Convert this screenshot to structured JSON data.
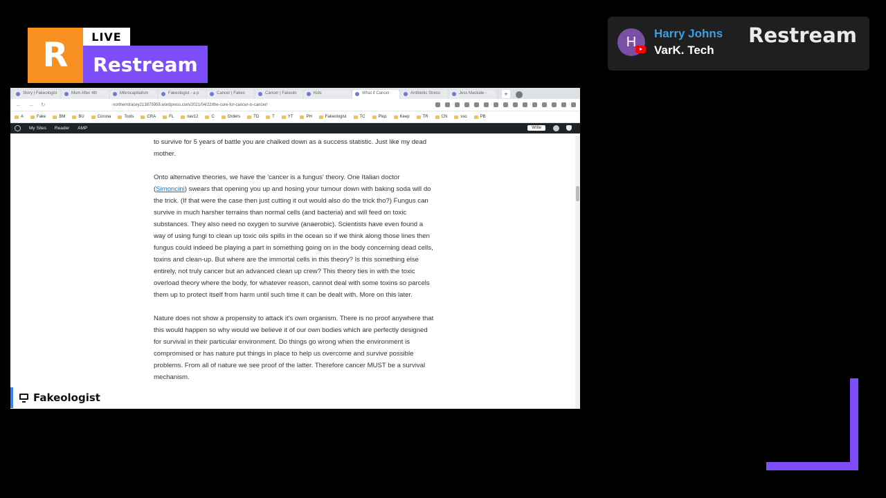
{
  "overlay": {
    "logo": {
      "letter": "R",
      "live": "LIVE",
      "brand": "Restream"
    },
    "chat": {
      "avatar_initial": "H",
      "author": "Harry Johns",
      "message": "VarK. Tech",
      "brand": "Restream"
    },
    "screen_label": "Fakeologist",
    "accent_color": "#7d4dfa",
    "orange_color": "#f7901e"
  },
  "browser": {
    "tabs": [
      {
        "label": "Story | Fakeologist"
      },
      {
        "label": "Mum After 4th"
      },
      {
        "label": "Mikrocapitalism"
      },
      {
        "label": "Fakeologist - a p"
      },
      {
        "label": "Cancer | Fakeo"
      },
      {
        "label": "Cancer | Fakeolo"
      },
      {
        "label": "Kids"
      },
      {
        "label": "What if Cancer"
      },
      {
        "label": "Antibiotic Stress"
      },
      {
        "label": "Jess Mackale -"
      }
    ],
    "new_tab": "+",
    "url": "northerntracey213875959.wordpress.com/2021/04/22/the-cure-for-cancer-is-cancer/",
    "bookmarks": [
      "A",
      "Fake",
      "BM",
      "BU",
      "Corona",
      "Tools",
      "CRA",
      "FL",
      "nav12",
      "C",
      "Orders",
      "TD",
      "T",
      "YT",
      "PH",
      "Fakeologist",
      "TC",
      "Plup",
      "Keep",
      "TR",
      "CN",
      "sso",
      "PB"
    ],
    "wp_toolbar": {
      "my_sites": "My Sites",
      "reader": "Reader",
      "amp": "AMP",
      "write": "Write"
    }
  },
  "article": {
    "p1": "to survive for 5 years of battle you are chalked down as a success statistic. Just like my dead mother.",
    "p2_a": "Onto alternative theories, we have the 'cancer is a fungus' theory. One Italian doctor (",
    "p2_link": "Simoncini",
    "p2_b": ") swears that opening you up and hosing your tumour down with baking soda will do the trick. (If that were the case then just cutting it out would also do the trick tho?) Fungus can survive in much harsher terrains than normal cells (and bacteria) and will feed on toxic substances. They also need no oxygen to survive (anaerobic). Scientists have even found a way of using fungi to clean up toxic oils spills in the ocean so if we think along those lines then fungus could indeed be playing a part in something going on in the body concerning dead cells, toxins and clean-up. But where are the immortal cells in this theory? Is this something else entirely, not truly cancer but an advanced clean up crew? This theory ties in with the toxic overload theory where the body, for whatever reason, cannot deal with some toxins so parcels them up to protect itself from harm until such time it can be dealt with. More on this later.",
    "p3": "Nature does not show a propensity to attack it's own organism. There is no proof anywhere that this would happen so why would we believe it of our own bodies which are perfectly designed for survival in their particular environment. Do things go wrong when the environment is compromised or has nature put things in place to help us overcome and survive possible problems. From all of nature we see proof of the latter. Therefore cancer MUST be a survival mechanism."
  }
}
